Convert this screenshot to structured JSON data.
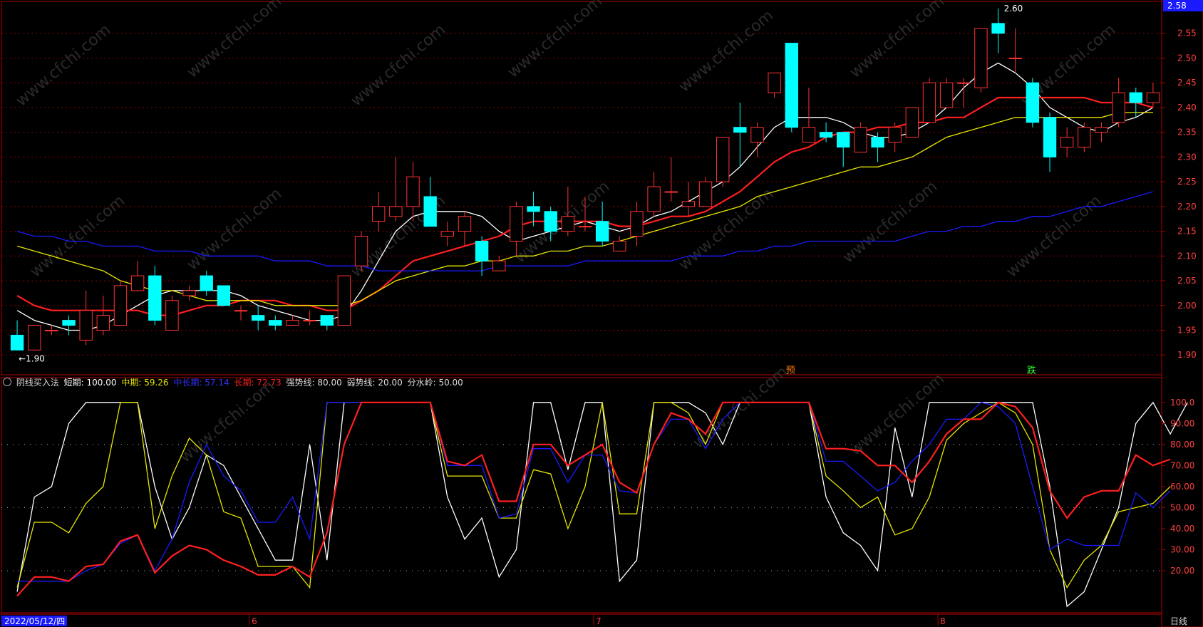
{
  "chart_data": [
    {
      "type": "candlestick",
      "price_axis": {
        "ylim": [
          1.86,
          2.6
        ],
        "ticks": [
          "2.55",
          "2.50",
          "2.45",
          "2.40",
          "2.35",
          "2.30",
          "2.25",
          "2.20",
          "2.15",
          "2.10",
          "2.05",
          "2.00",
          "1.95",
          "1.90"
        ],
        "current_price": "2.58"
      },
      "annotations": {
        "high": "2.60",
        "low": "←1.90",
        "signal_1": "预",
        "signal_2": "跌"
      },
      "candles": [
        {
          "o": 1.94,
          "c": 1.91,
          "h": 1.97,
          "l": 1.91
        },
        {
          "o": 1.91,
          "c": 1.96,
          "h": 1.96,
          "l": 1.91
        },
        {
          "o": 1.95,
          "c": 1.95,
          "h": 1.96,
          "l": 1.94
        },
        {
          "o": 1.97,
          "c": 1.96,
          "h": 1.98,
          "l": 1.94
        },
        {
          "o": 1.93,
          "c": 1.99,
          "h": 2.03,
          "l": 1.92
        },
        {
          "o": 1.95,
          "c": 1.98,
          "h": 2.02,
          "l": 1.94
        },
        {
          "o": 1.96,
          "c": 2.04,
          "h": 2.05,
          "l": 1.96
        },
        {
          "o": 2.03,
          "c": 2.06,
          "h": 2.09,
          "l": 2.03
        },
        {
          "o": 2.06,
          "c": 1.97,
          "h": 2.08,
          "l": 1.96
        },
        {
          "o": 1.95,
          "c": 2.01,
          "h": 2.02,
          "l": 1.95
        },
        {
          "o": 2.02,
          "c": 2.03,
          "h": 2.04,
          "l": 2.01
        },
        {
          "o": 2.06,
          "c": 2.03,
          "h": 2.07,
          "l": 2.02
        },
        {
          "o": 2.04,
          "c": 2.0,
          "h": 2.04,
          "l": 2.0
        },
        {
          "o": 1.99,
          "c": 1.99,
          "h": 2.0,
          "l": 1.97
        },
        {
          "o": 1.98,
          "c": 1.97,
          "h": 2.0,
          "l": 1.95
        },
        {
          "o": 1.97,
          "c": 1.96,
          "h": 1.98,
          "l": 1.95
        },
        {
          "o": 1.96,
          "c": 1.97,
          "h": 1.98,
          "l": 1.96
        },
        {
          "o": 1.97,
          "c": 1.97,
          "h": 1.99,
          "l": 1.96
        },
        {
          "o": 1.98,
          "c": 1.96,
          "h": 1.98,
          "l": 1.95
        },
        {
          "o": 1.96,
          "c": 2.06,
          "h": 2.06,
          "l": 1.96
        },
        {
          "o": 2.08,
          "c": 2.14,
          "h": 2.15,
          "l": 2.07
        },
        {
          "o": 2.17,
          "c": 2.2,
          "h": 2.23,
          "l": 2.15
        },
        {
          "o": 2.18,
          "c": 2.2,
          "h": 2.3,
          "l": 2.17
        },
        {
          "o": 2.2,
          "c": 2.26,
          "h": 2.29,
          "l": 2.17
        },
        {
          "o": 2.22,
          "c": 2.16,
          "h": 2.26,
          "l": 2.16
        },
        {
          "o": 2.14,
          "c": 2.15,
          "h": 2.17,
          "l": 2.12
        },
        {
          "o": 2.15,
          "c": 2.18,
          "h": 2.19,
          "l": 2.12
        },
        {
          "o": 2.13,
          "c": 2.09,
          "h": 2.14,
          "l": 2.06
        },
        {
          "o": 2.07,
          "c": 2.09,
          "h": 2.1,
          "l": 2.07
        },
        {
          "o": 2.13,
          "c": 2.2,
          "h": 2.21,
          "l": 2.1
        },
        {
          "o": 2.2,
          "c": 2.19,
          "h": 2.23,
          "l": 2.16
        },
        {
          "o": 2.19,
          "c": 2.15,
          "h": 2.2,
          "l": 2.13
        },
        {
          "o": 2.15,
          "c": 2.18,
          "h": 2.24,
          "l": 2.14
        },
        {
          "o": 2.16,
          "c": 2.16,
          "h": 2.22,
          "l": 2.15
        },
        {
          "o": 2.17,
          "c": 2.13,
          "h": 2.21,
          "l": 2.12
        },
        {
          "o": 2.11,
          "c": 2.13,
          "h": 2.14,
          "l": 2.11
        },
        {
          "o": 2.14,
          "c": 2.19,
          "h": 2.21,
          "l": 2.12
        },
        {
          "o": 2.19,
          "c": 2.24,
          "h": 2.27,
          "l": 2.18
        },
        {
          "o": 2.23,
          "c": 2.23,
          "h": 2.3,
          "l": 2.21
        },
        {
          "o": 2.2,
          "c": 2.21,
          "h": 2.25,
          "l": 2.18
        },
        {
          "o": 2.2,
          "c": 2.25,
          "h": 2.26,
          "l": 2.2
        },
        {
          "o": 2.25,
          "c": 2.34,
          "h": 2.34,
          "l": 2.24
        },
        {
          "o": 2.36,
          "c": 2.35,
          "h": 2.41,
          "l": 2.28
        },
        {
          "o": 2.33,
          "c": 2.36,
          "h": 2.37,
          "l": 2.3
        },
        {
          "o": 2.43,
          "c": 2.47,
          "h": 2.47,
          "l": 2.42
        },
        {
          "o": 2.53,
          "c": 2.36,
          "h": 2.53,
          "l": 2.35
        },
        {
          "o": 2.33,
          "c": 2.36,
          "h": 2.44,
          "l": 2.33
        },
        {
          "o": 2.35,
          "c": 2.34,
          "h": 2.37,
          "l": 2.33
        },
        {
          "o": 2.35,
          "c": 2.32,
          "h": 2.35,
          "l": 2.28
        },
        {
          "o": 2.31,
          "c": 2.36,
          "h": 2.37,
          "l": 2.31
        },
        {
          "o": 2.34,
          "c": 2.32,
          "h": 2.35,
          "l": 2.29
        },
        {
          "o": 2.33,
          "c": 2.36,
          "h": 2.37,
          "l": 2.31
        },
        {
          "o": 2.34,
          "c": 2.4,
          "h": 2.4,
          "l": 2.34
        },
        {
          "o": 2.37,
          "c": 2.45,
          "h": 2.46,
          "l": 2.37
        },
        {
          "o": 2.4,
          "c": 2.45,
          "h": 2.46,
          "l": 2.4
        },
        {
          "o": 2.45,
          "c": 2.45,
          "h": 2.46,
          "l": 2.4
        },
        {
          "o": 2.44,
          "c": 2.56,
          "h": 2.56,
          "l": 2.43
        },
        {
          "o": 2.57,
          "c": 2.55,
          "h": 2.6,
          "l": 2.51
        },
        {
          "o": 2.5,
          "c": 2.5,
          "h": 2.56,
          "l": 2.47
        },
        {
          "o": 2.45,
          "c": 2.37,
          "h": 2.46,
          "l": 2.36
        },
        {
          "o": 2.38,
          "c": 2.3,
          "h": 2.39,
          "l": 2.27
        },
        {
          "o": 2.32,
          "c": 2.34,
          "h": 2.36,
          "l": 2.3
        },
        {
          "o": 2.32,
          "c": 2.36,
          "h": 2.37,
          "l": 2.31
        },
        {
          "o": 2.35,
          "c": 2.36,
          "h": 2.37,
          "l": 2.33
        },
        {
          "o": 2.37,
          "c": 2.43,
          "h": 2.46,
          "l": 2.36
        },
        {
          "o": 2.43,
          "c": 2.41,
          "h": 2.44,
          "l": 2.38
        },
        {
          "o": 2.41,
          "c": 2.43,
          "h": 2.45,
          "l": 2.4
        }
      ],
      "moving_averages": [
        {
          "color": "#ffffff",
          "values": [
            1.99,
            1.97,
            1.96,
            1.95,
            1.95,
            1.96,
            1.98,
            2.0,
            2.02,
            2.03,
            2.03,
            2.03,
            2.03,
            2.02,
            2.0,
            1.99,
            1.98,
            1.97,
            1.97,
            1.98,
            2.03,
            2.09,
            2.15,
            2.18,
            2.19,
            2.19,
            2.19,
            2.18,
            2.15,
            2.13,
            2.14,
            2.15,
            2.16,
            2.17,
            2.16,
            2.15,
            2.16,
            2.18,
            2.19,
            2.21,
            2.23,
            2.25,
            2.28,
            2.32,
            2.36,
            2.38,
            2.38,
            2.38,
            2.37,
            2.35,
            2.34,
            2.34,
            2.35,
            2.37,
            2.4,
            2.44,
            2.47,
            2.49,
            2.47,
            2.44,
            2.4,
            2.38,
            2.36,
            2.35,
            2.37,
            2.38,
            2.4
          ]
        },
        {
          "color": "#ff1f1f",
          "values": [
            2.02,
            2.0,
            1.99,
            1.99,
            1.99,
            1.99,
            1.99,
            1.99,
            1.98,
            1.98,
            1.99,
            2.0,
            2.0,
            2.01,
            2.01,
            2.01,
            2.0,
            2.0,
            1.99,
            1.99,
            2.01,
            2.03,
            2.06,
            2.09,
            2.1,
            2.11,
            2.12,
            2.13,
            2.14,
            2.16,
            2.17,
            2.17,
            2.17,
            2.17,
            2.17,
            2.16,
            2.16,
            2.17,
            2.18,
            2.18,
            2.19,
            2.21,
            2.23,
            2.26,
            2.29,
            2.31,
            2.32,
            2.34,
            2.35,
            2.35,
            2.36,
            2.36,
            2.37,
            2.37,
            2.38,
            2.38,
            2.4,
            2.42,
            2.42,
            2.42,
            2.42,
            2.42,
            2.42,
            2.41,
            2.41,
            2.41,
            2.4
          ]
        },
        {
          "color": "#e6e600",
          "values": [
            2.12,
            2.11,
            2.1,
            2.09,
            2.08,
            2.07,
            2.05,
            2.04,
            2.03,
            2.03,
            2.02,
            2.01,
            2.01,
            2.01,
            2.01,
            2.0,
            2.0,
            2.0,
            2.0,
            2.0,
            2.01,
            2.03,
            2.05,
            2.06,
            2.07,
            2.08,
            2.08,
            2.09,
            2.09,
            2.1,
            2.1,
            2.11,
            2.11,
            2.12,
            2.12,
            2.13,
            2.14,
            2.15,
            2.16,
            2.17,
            2.18,
            2.19,
            2.2,
            2.22,
            2.23,
            2.24,
            2.25,
            2.26,
            2.27,
            2.28,
            2.28,
            2.29,
            2.3,
            2.32,
            2.34,
            2.35,
            2.36,
            2.37,
            2.38,
            2.38,
            2.38,
            2.38,
            2.38,
            2.38,
            2.39,
            2.39,
            2.39
          ]
        },
        {
          "color": "#1a1aff",
          "values": [
            2.15,
            2.14,
            2.14,
            2.13,
            2.13,
            2.12,
            2.12,
            2.12,
            2.11,
            2.11,
            2.11,
            2.1,
            2.1,
            2.1,
            2.1,
            2.09,
            2.09,
            2.09,
            2.08,
            2.08,
            2.08,
            2.07,
            2.07,
            2.07,
            2.07,
            2.07,
            2.07,
            2.07,
            2.08,
            2.08,
            2.08,
            2.08,
            2.08,
            2.09,
            2.09,
            2.09,
            2.09,
            2.09,
            2.09,
            2.1,
            2.1,
            2.1,
            2.11,
            2.11,
            2.12,
            2.12,
            2.13,
            2.13,
            2.13,
            2.13,
            2.13,
            2.13,
            2.14,
            2.15,
            2.15,
            2.16,
            2.16,
            2.17,
            2.17,
            2.18,
            2.18,
            2.19,
            2.2,
            2.2,
            2.21,
            2.22,
            2.23
          ]
        }
      ]
    },
    {
      "type": "line",
      "title": "阴线买入法",
      "legend": [
        {
          "label": "短期: 100.00",
          "color": "#ffffff"
        },
        {
          "label": "中期: 59.26",
          "color": "#e6e600"
        },
        {
          "label": "中长期: 57.14",
          "color": "#1a1aff"
        },
        {
          "label": "长期: 72.73",
          "color": "#ff1f1f"
        },
        {
          "label": "强势线: 80.00",
          "color": "#dddddd"
        },
        {
          "label": "弱势线: 20.00",
          "color": "#dddddd"
        },
        {
          "label": "分水岭: 50.00",
          "color": "#dddddd"
        }
      ],
      "ylim": [
        0,
        105
      ],
      "ticks": [
        "100.0",
        "90.00",
        "80.00",
        "70.00",
        "60.00",
        "50.00",
        "40.00",
        "30.00",
        "20.00"
      ],
      "reference_levels": [
        80,
        50,
        20
      ],
      "series": [
        {
          "name": "短期",
          "color": "#ffffff",
          "values": [
            10,
            55,
            60,
            90,
            100,
            100,
            100,
            100,
            60,
            35,
            50,
            75,
            70,
            55,
            40,
            25,
            25,
            80,
            25,
            100,
            100,
            100,
            100,
            100,
            100,
            55,
            35,
            45,
            17,
            30,
            100,
            100,
            68,
            100,
            100,
            15,
            25,
            100,
            100,
            100,
            95,
            80,
            100,
            100,
            100,
            100,
            100,
            55,
            38,
            32,
            20,
            88,
            55,
            100,
            100,
            100,
            100,
            100,
            100,
            100,
            60,
            3,
            10,
            30,
            50,
            90,
            100,
            85,
            100
          ]
        },
        {
          "name": "中期",
          "color": "#e6e600",
          "values": [
            12,
            43,
            43,
            38,
            52,
            60,
            100,
            100,
            40,
            65,
            83,
            75,
            48,
            45,
            22,
            22,
            22,
            12,
            100,
            100,
            100,
            100,
            100,
            100,
            100,
            65,
            65,
            65,
            45,
            45,
            68,
            66,
            40,
            60,
            100,
            47,
            47,
            100,
            100,
            95,
            80,
            100,
            100,
            100,
            100,
            100,
            100,
            65,
            58,
            50,
            55,
            37,
            40,
            55,
            82,
            90,
            95,
            100,
            95,
            80,
            30,
            12,
            25,
            32,
            48,
            50,
            52,
            60
          ]
        },
        {
          "name": "中长期",
          "color": "#1a1aff",
          "values": [
            15,
            15,
            15,
            15,
            20,
            23,
            33,
            37,
            20,
            35,
            62,
            80,
            65,
            58,
            43,
            43,
            55,
            35,
            100,
            100,
            100,
            100,
            100,
            100,
            100,
            70,
            70,
            70,
            45,
            47,
            78,
            78,
            62,
            75,
            75,
            58,
            57,
            80,
            92,
            92,
            78,
            92,
            100,
            100,
            100,
            100,
            100,
            72,
            72,
            65,
            58,
            62,
            72,
            80,
            92,
            92,
            100,
            98,
            90,
            60,
            30,
            35,
            32,
            32,
            32,
            57,
            50,
            58
          ]
        },
        {
          "name": "长期",
          "color": "#ff1f1f",
          "values": [
            8,
            17,
            17,
            15,
            22,
            23,
            34,
            37,
            19,
            27,
            32,
            30,
            25,
            22,
            18,
            18,
            22,
            17,
            38,
            80,
            100,
            100,
            100,
            100,
            100,
            72,
            70,
            75,
            53,
            53,
            80,
            80,
            70,
            75,
            80,
            62,
            57,
            80,
            95,
            92,
            85,
            100,
            100,
            100,
            100,
            100,
            100,
            78,
            78,
            77,
            70,
            70,
            62,
            72,
            85,
            92,
            92,
            100,
            98,
            88,
            58,
            45,
            55,
            58,
            58,
            75,
            70,
            73
          ]
        }
      ]
    }
  ],
  "xaxis": {
    "date_label": "2022/05/12/四",
    "month_markers": [
      {
        "label": "6",
        "index": 14
      },
      {
        "label": "7",
        "index": 34
      },
      {
        "label": "8",
        "index": 54
      }
    ],
    "period_label": "日线"
  },
  "watermark": "www.cfchi.com",
  "colors": {
    "up": "#ff3232",
    "down": "#00ffff",
    "grid": "#8b0000",
    "axis": "#b00000",
    "axis_text": "#ff4040"
  }
}
